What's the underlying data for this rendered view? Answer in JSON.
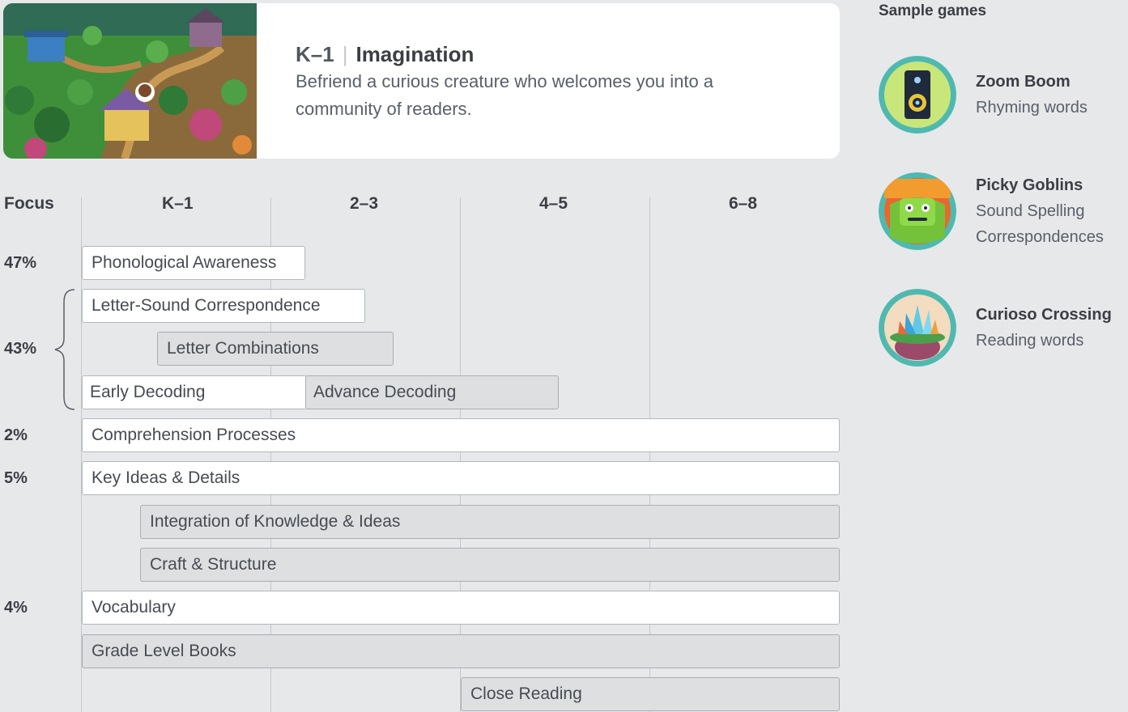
{
  "hero": {
    "grade": "K–1",
    "title": "Imagination",
    "description": "Befriend a curious creature who welcomes you into a community of readers."
  },
  "grid": {
    "focus_header": "Focus",
    "columns": [
      "K–1",
      "2–3",
      "4–5",
      "6–8"
    ],
    "focus_values": {
      "phonological": "47%",
      "phonics": "43%",
      "comprehension": "2%",
      "key_ideas": "5%",
      "vocabulary": "4%"
    },
    "bars": {
      "phonological_awareness": "Phonological Awareness",
      "letter_sound": "Letter-Sound Correspondence",
      "letter_combinations": "Letter Combinations",
      "early_decoding": "Early Decoding",
      "advance_decoding": "Advance Decoding",
      "comprehension_processes": "Comprehension Processes",
      "key_ideas": "Key Ideas & Details",
      "integration": "Integration of Knowledge & Ideas",
      "craft": "Craft & Structure",
      "vocabulary": "Vocabulary",
      "grade_level_books": "Grade Level Books",
      "close_reading": "Close Reading"
    }
  },
  "sidebar": {
    "title": "Sample games",
    "games": [
      {
        "name": "Zoom Boom",
        "desc": "Rhyming words",
        "icon": "speaker-icon"
      },
      {
        "name": "Picky Goblins",
        "desc": "Sound Spelling Correspondences",
        "icon": "goblin-icon"
      },
      {
        "name": "Curioso Crossing",
        "desc": "Reading words",
        "icon": "crystal-icon"
      }
    ]
  },
  "colors": {
    "background": "#e7e8ea",
    "bar_white": "#ffffff",
    "bar_gray": "#dedfe1",
    "icon_ring": "#4fb9b0"
  }
}
